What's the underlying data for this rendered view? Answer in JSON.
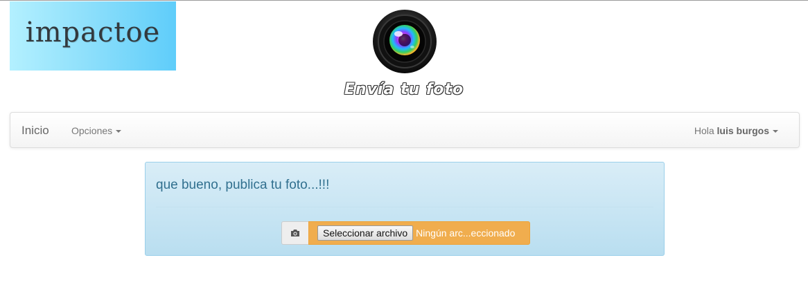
{
  "header": {
    "logo_text": "impactoe",
    "tagline": "Envía tu foto"
  },
  "navbar": {
    "brand": "Inicio",
    "options_label": "Opciones",
    "greeting": "Hola",
    "username": "luis burgos"
  },
  "main": {
    "message": "que bueno, publica tu foto...!!!",
    "upload": {
      "button_label": "Seleccionar archivo",
      "status_text": "Ningún arc...eccionado",
      "icon": "camera-icon"
    }
  },
  "colors": {
    "logo_bg": "#5fcdfa",
    "panel_bg": "#d9edf7",
    "panel_text": "#31708f",
    "upload_accent": "#f0ad4e"
  }
}
